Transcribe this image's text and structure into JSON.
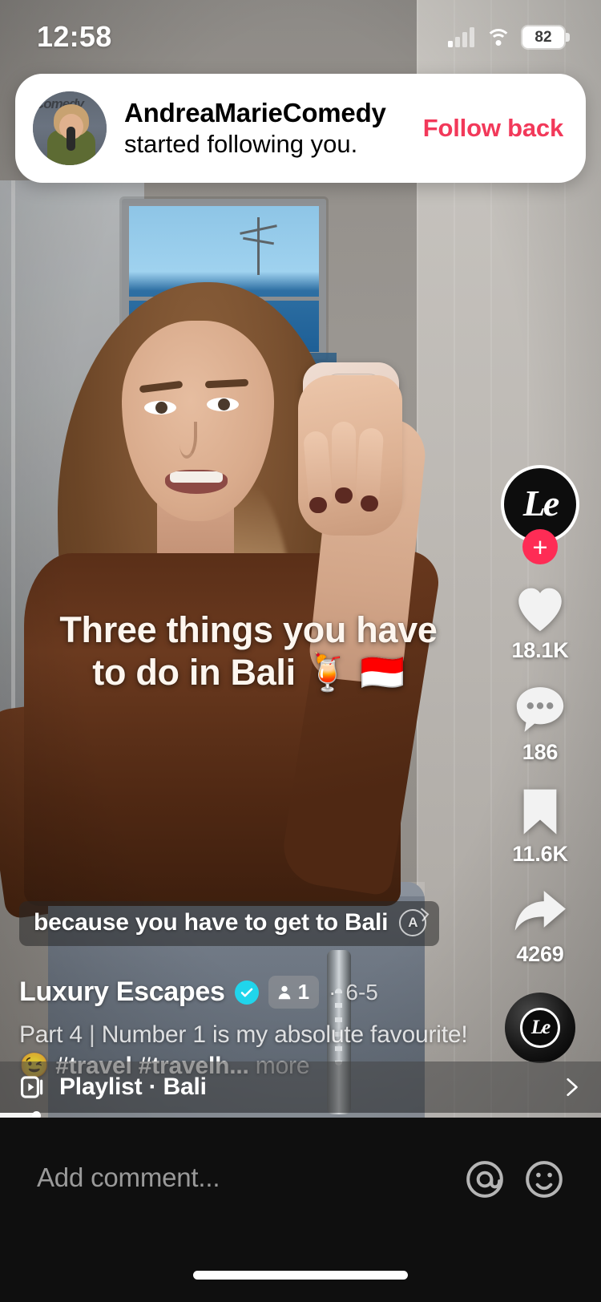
{
  "status_bar": {
    "time": "12:58",
    "battery_percent": "82",
    "signal_icon": "cellular-signal-icon",
    "wifi_icon": "wifi-icon",
    "battery_icon": "battery-icon"
  },
  "notification": {
    "username": "AndreaMarieComedy",
    "message": "started following you.",
    "action_label": "Follow back",
    "action_color": "#f2395a",
    "avatar_name": "notification-avatar"
  },
  "video": {
    "caption_line1": "Three things you have",
    "caption_line2": "to do in Bali 🍹 🇮🇩",
    "subtitle": "because you have to get to Bali",
    "auto_caption_badge": "A"
  },
  "author": {
    "name": "Luxury Escapes",
    "verified": true,
    "friend_count": "1",
    "date": "6-5",
    "separator": "·"
  },
  "description": {
    "part": "Part 4",
    "divider": "|",
    "text": "Number 1 is my absolute favourite! 😉",
    "hashtags": "#travel #travelh...",
    "more_label": "more",
    "full": "Part 4 | Number 1 is my absolute favourite! 😉 #travel #travelh... more"
  },
  "actions": {
    "avatar_logo": "Le",
    "follow_icon": "plus-icon",
    "like": {
      "icon": "heart-icon",
      "count": "18.1K"
    },
    "comment": {
      "icon": "comment-bubble-icon",
      "count": "186"
    },
    "bookmark": {
      "icon": "bookmark-icon",
      "count": "11.6K"
    },
    "share": {
      "icon": "share-arrow-icon",
      "count": "4269"
    },
    "music_disc": {
      "icon": "music-disc-icon",
      "logo": "Le"
    }
  },
  "playlist": {
    "icon": "playlist-icon",
    "label": "Playlist · Bali",
    "chevron_icon": "chevron-right-icon"
  },
  "progress": {
    "percent": 6
  },
  "comment_bar": {
    "placeholder": "Add comment...",
    "mention_icon": "at-sign-icon",
    "emoji_icon": "emoji-face-icon"
  },
  "colors": {
    "accent_red": "#fe2c55",
    "verified_blue": "#20d5ec",
    "banner_bg": "#ffffff",
    "bottom_bar": "#0f0f0f"
  }
}
